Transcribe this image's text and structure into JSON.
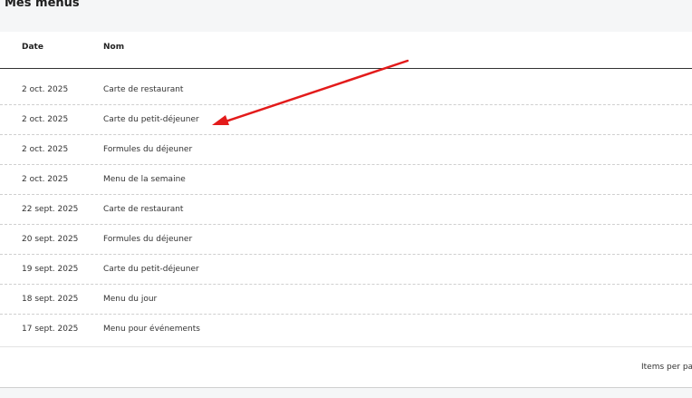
{
  "page": {
    "title": "Mes menus"
  },
  "table": {
    "headers": {
      "date": "Date",
      "nom": "Nom"
    },
    "rows": [
      {
        "date": "2 oct. 2025",
        "nom": "Carte de restaurant"
      },
      {
        "date": "2 oct. 2025",
        "nom": "Carte du petit-déjeuner"
      },
      {
        "date": "2 oct. 2025",
        "nom": "Formules du déjeuner"
      },
      {
        "date": "2 oct. 2025",
        "nom": "Menu de la semaine"
      },
      {
        "date": "22 sept. 2025",
        "nom": "Carte de restaurant"
      },
      {
        "date": "20 sept. 2025",
        "nom": "Formules du déjeuner"
      },
      {
        "date": "19 sept. 2025",
        "nom": "Carte du petit-déjeuner"
      },
      {
        "date": "18 sept. 2025",
        "nom": "Menu du jour"
      },
      {
        "date": "17 sept. 2025",
        "nom": "Menu pour événements"
      }
    ]
  },
  "pagination": {
    "items_per_page_label": "Items per page"
  },
  "annotation": {
    "arrow_color": "#e31b1b"
  }
}
